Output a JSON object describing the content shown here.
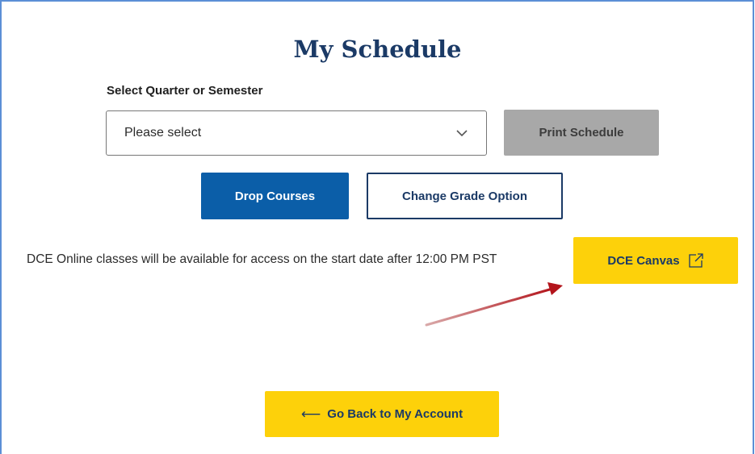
{
  "page": {
    "title": "My Schedule"
  },
  "term_select": {
    "label": "Select Quarter or Semester",
    "value": "Please select",
    "icon": "chevron-down-icon"
  },
  "buttons": {
    "print": "Print Schedule",
    "drop": "Drop Courses",
    "change_grade": "Change Grade Option",
    "canvas": "DCE Canvas",
    "back_arrow": "⟵",
    "back": "Go Back to My Account"
  },
  "notice": {
    "text": "DCE Online classes will be available for access on the start date after 12:00 PM PST"
  },
  "colors": {
    "primary_blue": "#0b5ea8",
    "navy": "#1b3a66",
    "yellow": "#fdd10a",
    "disabled_gray": "#a8a8a8",
    "annotation_red": "#b3141b"
  }
}
